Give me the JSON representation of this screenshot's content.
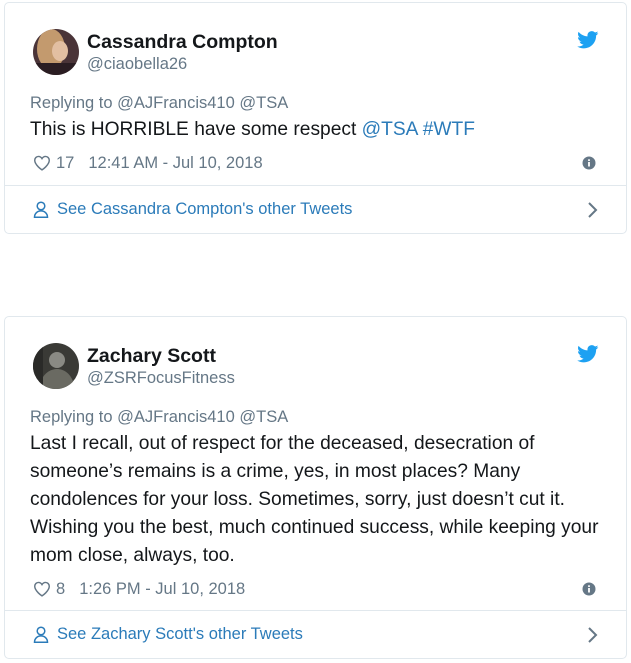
{
  "tweets": [
    {
      "display_name": "Cassandra Compton",
      "handle": "@ciaobella26",
      "reply_prefix": "Replying to",
      "reply_mentions": "@AJFrancis410 @TSA",
      "text_plain": "This is HORRIBLE have some respect ",
      "text_link_1": "@TSA",
      "text_link_2": "#WTF",
      "likes": "17",
      "timestamp": "12:41 AM - Jul 10, 2018",
      "footer_label": "See Cassandra Compton's other Tweets",
      "avatar_colors": [
        "#3a2a2e",
        "#c9a27a",
        "#7a4b3a"
      ]
    },
    {
      "display_name": "Zachary Scott",
      "handle": "@ZSRFocusFitness",
      "reply_prefix": "Replying to",
      "reply_mentions": "@AJFrancis410 @TSA",
      "text_plain": "Last I recall, out of respect for the deceased, desecration of someone’s remains is a crime, yes, in most places? Many condolences for your loss. Sometimes, sorry, just doesn’t cut it. Wishing you the best, much continued success, while keeping your mom close, always, too.",
      "likes": "8",
      "timestamp": "1:26 PM - Jul 10, 2018",
      "footer_label": "See Zachary Scott's other Tweets",
      "avatar_colors": [
        "#2e2e2e",
        "#8a8a84",
        "#5a5a52"
      ]
    }
  ],
  "colors": {
    "twitter_blue": "#1da1f2",
    "link_blue": "#2b7bb9",
    "muted_gray": "#657786",
    "border": "#e1e8ed",
    "text": "#14171a"
  },
  "icons": {
    "brand": "twitter-bird-icon",
    "like": "heart-icon",
    "info": "info-icon",
    "profile": "person-icon",
    "more": "chevron-right-icon"
  }
}
